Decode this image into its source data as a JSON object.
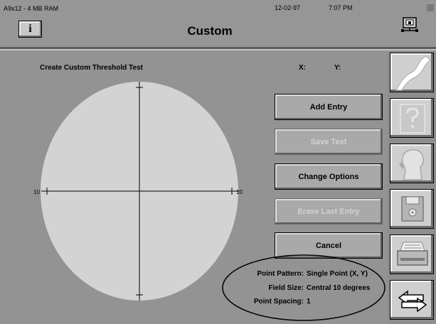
{
  "header": {
    "system_info": "A9x12 - 4 MB RAM",
    "date": "12-02-97",
    "time": "7:07 PM",
    "title": "Custom",
    "info_button_label": "i"
  },
  "workspace": {
    "title": "Create Custom Threshold Test",
    "x_label": "X:",
    "y_label": "Y:",
    "axis_left_label": "10",
    "axis_right_label": "10"
  },
  "actions": [
    {
      "label": "Add Entry",
      "enabled": true
    },
    {
      "label": "Save Test",
      "enabled": false
    },
    {
      "label": "Change Options",
      "enabled": true
    },
    {
      "label": "Erase Last Entry",
      "enabled": false
    },
    {
      "label": "Cancel",
      "enabled": true
    }
  ],
  "settings": {
    "point_pattern_label": "Point Pattern:",
    "point_pattern_value": "Single Point (X, Y)",
    "field_size_label": "Field Size:",
    "field_size_value": "Central 10 degrees",
    "point_spacing_label": "Point Spacing:",
    "point_spacing_value": "1"
  },
  "side_tools": [
    {
      "icon": "curve-icon",
      "enabled": true
    },
    {
      "icon": "question-mark-icon",
      "enabled": false
    },
    {
      "icon": "patient-profile-icon",
      "enabled": false
    },
    {
      "icon": "floppy-disk-icon",
      "enabled": true
    },
    {
      "icon": "printer-icon",
      "enabled": true
    },
    {
      "icon": "return-arrow-icon",
      "enabled": true
    }
  ],
  "colors": {
    "background": "#939393",
    "field": "#d3d3d3",
    "button": "#a9a9a9"
  }
}
